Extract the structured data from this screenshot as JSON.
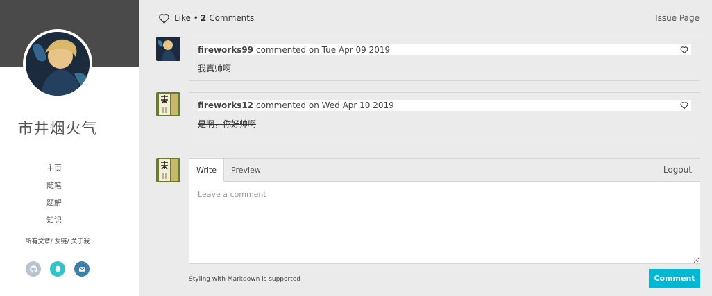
{
  "sidebar": {
    "title": "市井烟火气",
    "nav": [
      "主页",
      "随笔",
      "题解",
      "知识"
    ],
    "sub_links": "所有文章/ 友链/ 关于我",
    "socials": [
      {
        "icon": "github-icon",
        "color": "#b9c3cf"
      },
      {
        "icon": "qq-icon",
        "color": "#33c3c9"
      },
      {
        "icon": "email-icon",
        "color": "#3b7fa8"
      }
    ]
  },
  "topbar": {
    "like_label": "Like •",
    "comment_count": "2",
    "comments_label": "Comments",
    "issue_page": "Issue Page"
  },
  "comments": [
    {
      "author": "fireworks99",
      "meta": "commented on Tue Apr 09 2019",
      "body": "我真帅啊"
    },
    {
      "author": "fireworks12",
      "meta": "commented on Wed Apr 10 2019",
      "body": "是啊，你好帅啊"
    }
  ],
  "editor": {
    "tab_write": "Write",
    "tab_preview": "Preview",
    "logout": "Logout",
    "placeholder": "Leave a comment",
    "footnote": "Styling with Markdown is supported",
    "submit": "Comment"
  },
  "colors": {
    "accent": "#00b8d4",
    "background": "#ebebeb",
    "cover": "#4a4a4a"
  }
}
